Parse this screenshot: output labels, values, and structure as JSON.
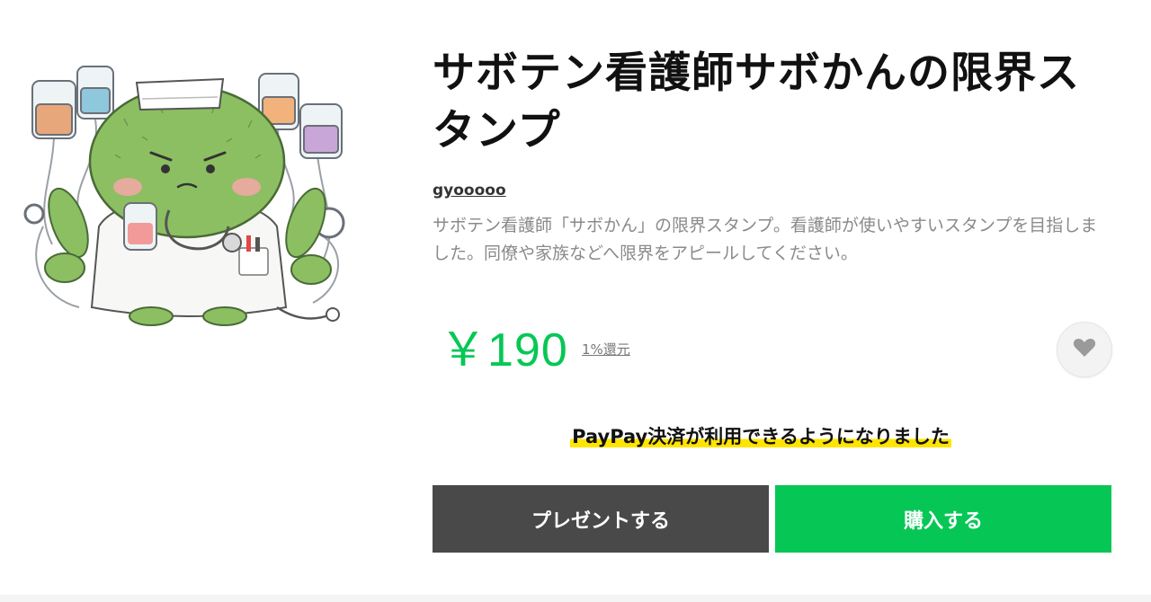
{
  "product": {
    "title": "サボテン看護師サボかんの限界スタンプ",
    "author": "gyooooo",
    "description": "サボテン看護師「サボかん」の限界スタンプ。看護師が使いやすいスタンプを目指しました。同僚や家族などへ限界をアピールしてください。",
    "price": "￥190",
    "reward": "1%還元",
    "image_icon": "cactus-nurse-sticker-icon"
  },
  "notice": {
    "text": "PayPay決済が利用できるようになりました",
    "highlight_color": "#ffe400"
  },
  "buttons": {
    "gift_label": "プレゼントする",
    "buy_label": "購入する"
  },
  "colors": {
    "accent": "#06c755",
    "gift_button": "#494949"
  },
  "icons": {
    "favorite": "heart-icon"
  }
}
